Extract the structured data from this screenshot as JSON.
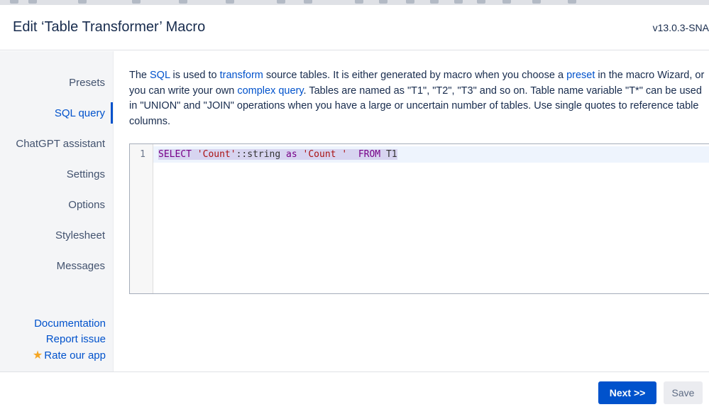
{
  "header": {
    "title": "Edit ‘Table Transformer’ Macro",
    "version": "v13.0.3-SNA"
  },
  "sidebar": {
    "items": [
      {
        "label": "Presets"
      },
      {
        "label": "SQL query",
        "active": true
      },
      {
        "label": "ChatGPT assistant"
      },
      {
        "label": "Settings"
      },
      {
        "label": "Options"
      },
      {
        "label": "Stylesheet"
      },
      {
        "label": "Messages"
      }
    ],
    "links": {
      "documentation": "Documentation",
      "report_issue": "Report issue",
      "rate_app": "Rate our app"
    }
  },
  "description": {
    "t1": "The ",
    "link_sql": "SQL",
    "t2": " is used to ",
    "link_transform": "transform",
    "t3": " source tables. It is either generated by macro when you choose a ",
    "link_preset": "preset",
    "t4": " in the macro Wizard, or you can write your own ",
    "link_complex": "complex query",
    "t5": ". Tables are named as \"T1\", \"T2\", \"T3\" and so on. Table name variable \"T*\" can be used in \"UNION\" and \"JOIN\" operations when you have a large or uncertain number of tables. Use single quotes to reference table columns."
  },
  "editor": {
    "line_number": "1",
    "tokens": {
      "select": "SELECT",
      "sp1": " ",
      "str1": "'Count'",
      "cast": "::string ",
      "as": "as",
      "sp2": " ",
      "str2": "'Count '",
      "sp3": "  ",
      "from": "FROM",
      "table": " T1"
    }
  },
  "footer": {
    "next_label": "Next >>",
    "save_label": "Save"
  },
  "colors": {
    "accent": "#0052cc",
    "sidebar_bg": "#f4f5f7",
    "star": "#f5a623"
  },
  "icons": {
    "rate": "star-icon"
  }
}
